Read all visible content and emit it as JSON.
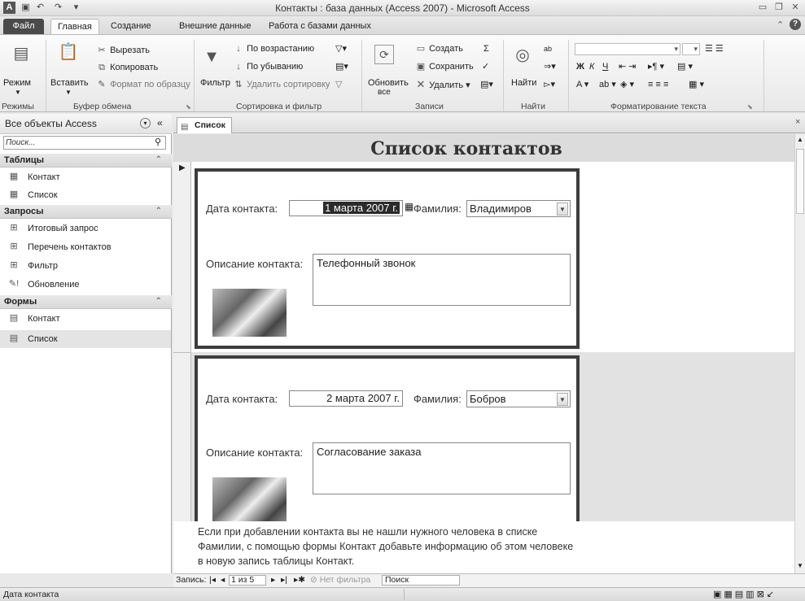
{
  "window": {
    "title": "Контакты : база данных (Access 2007)  -  Microsoft Access"
  },
  "ribbon_tabs": [
    "Файл",
    "Главная",
    "Создание",
    "Внешние данные",
    "Работа с базами данных"
  ],
  "ribbon": {
    "views": {
      "mode_label": "Режим",
      "group_label": "Режимы"
    },
    "clipboard": {
      "paste_label": "Вставить",
      "cut_label": "Вырезать",
      "copy_label": "Копировать",
      "format_painter_label": "Формат по образцу",
      "group_label": "Буфер обмена"
    },
    "sort_filter": {
      "filter_label": "Фильтр",
      "ascending_label": "По возрастанию",
      "descending_label": "По убыванию",
      "remove_sort_label": "Удалить сортировку",
      "group_label": "Сортировка и фильтр"
    },
    "records": {
      "refresh_label": "Обновить",
      "refresh_sub": "все",
      "new_label": "Создать",
      "save_label": "Сохранить",
      "delete_label": "Удалить",
      "group_label": "Записи"
    },
    "find": {
      "find_label": "Найти",
      "group_label": "Найти"
    },
    "text_format": {
      "bold": "Ж",
      "italic": "К",
      "underline": "Ч",
      "font_color": "A",
      "group_label": "Форматирование текста"
    }
  },
  "nav_pane": {
    "header": "Все объекты Access",
    "search_placeholder": "Поиск...",
    "groups": [
      {
        "label": "Таблицы",
        "items": [
          "Контакт",
          "Список"
        ]
      },
      {
        "label": "Запросы",
        "items": [
          "Итоговый запрос",
          "Перечень контактов",
          "Фильтр",
          "Обновление"
        ]
      },
      {
        "label": "Формы",
        "items": [
          "Контакт",
          "Список"
        ]
      }
    ]
  },
  "document": {
    "tab_label": "Список",
    "form_title": "Список контактов",
    "labels": {
      "date": "Дата контакта:",
      "surname": "Фамилия:",
      "description": "Описание контакта:"
    },
    "records": [
      {
        "date": "1 марта 2007 г.",
        "surname": "Владимиров",
        "description": "Телефонный звонок"
      },
      {
        "date": "2 марта 2007 г.",
        "surname": "Бобров",
        "description": "Согласование заказа"
      }
    ],
    "footer_note": "Если при добавлении контакта вы не нашли нужного человека в списке Фамилии, с помощью формы Контакт добавьте информацию об этом человеке в новую запись таблицы Контакт."
  },
  "record_nav": {
    "label": "Запись:",
    "position": "1 из 5",
    "filter_status": "Нет фильтра",
    "search_label": "Поиск"
  },
  "status_bar": {
    "text": "Дата контакта"
  },
  "icons": {
    "access_logo": "access-logo-icon",
    "save": "save-icon",
    "undo": "undo-icon",
    "redo": "redo-icon",
    "help": "help-icon"
  }
}
